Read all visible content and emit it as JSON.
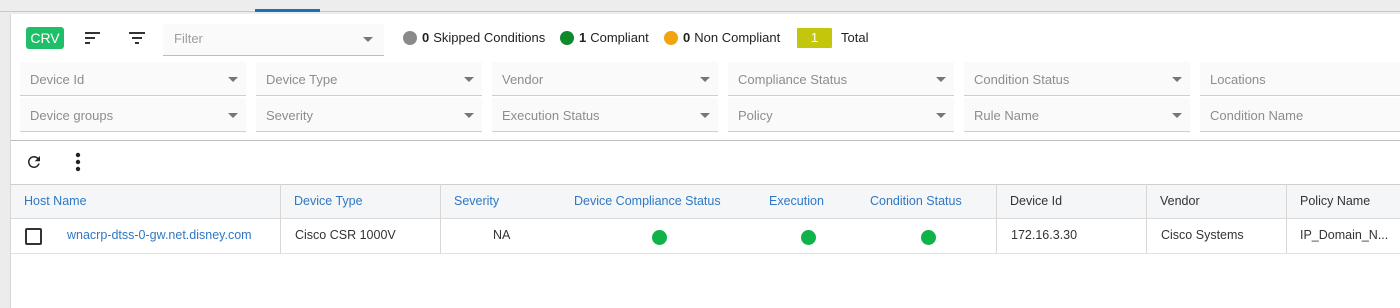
{
  "toolbar": {
    "crv_label": "CRV",
    "filter_placeholder": "Filter",
    "skipped": {
      "count": "0",
      "label": "Skipped Conditions",
      "color": "#8a8a8a"
    },
    "compliant": {
      "count": "1",
      "label": "Compliant",
      "color": "#0e8a2a"
    },
    "non_compliant": {
      "count": "0",
      "label": "Non Compliant",
      "color": "#f2a30f"
    },
    "total": {
      "count": "1",
      "label": "Total",
      "color": "#c2c70b"
    },
    "sort_icon": "sort-icon",
    "filter_icon": "filter-icon"
  },
  "filters": {
    "row1": [
      "Device Id",
      "Device Type",
      "Vendor",
      "Compliance Status",
      "Condition Status",
      "Locations"
    ],
    "row2": [
      "Device groups",
      "Severity",
      "Execution Status",
      "Policy",
      "Rule Name",
      "Condition Name"
    ]
  },
  "table_toolbar": {
    "refresh_icon": "refresh-icon",
    "more_icon": "more-vertical-icon"
  },
  "table": {
    "columns": [
      "Host Name",
      "Device Type",
      "Severity",
      "Device Compliance Status",
      "Execution",
      "Condition Status",
      "Device Id",
      "Vendor",
      "Policy Name"
    ],
    "rows": [
      {
        "host_name": "wnacrp-dtss-0-gw.net.disney.com",
        "device_type": "Cisco CSR 1000V",
        "severity": "NA",
        "compliance_status": "compliant",
        "execution": "success",
        "condition_status": "compliant",
        "device_id": "172.16.3.30",
        "vendor": "Cisco Systems",
        "policy_name": "IP_Domain_N..."
      }
    ],
    "status_color": "#10b34a",
    "link_color": "#2f78c4"
  }
}
